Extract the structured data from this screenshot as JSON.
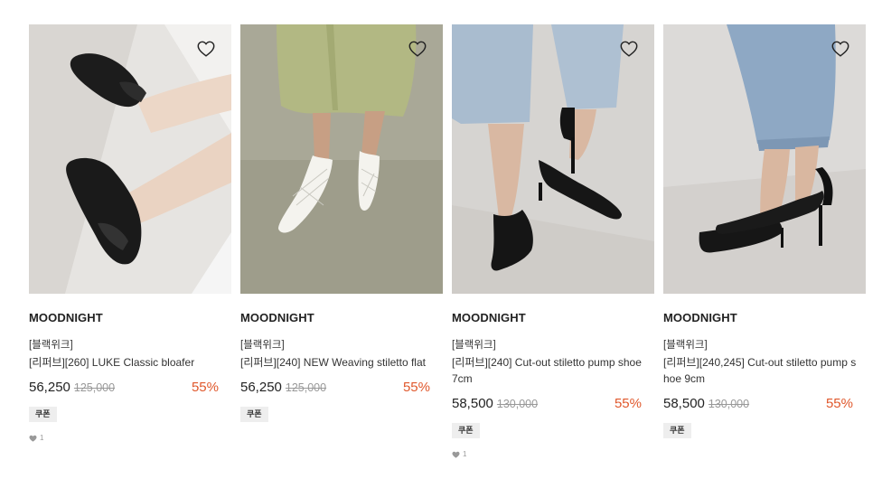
{
  "products": [
    {
      "brand": "MOODNIGHT",
      "tag": "[블랙위크]",
      "name": "[리퍼브][260] LUKE Classic bloafer",
      "price": "56,250",
      "original_price": "125,000",
      "discount": "55%",
      "coupon": "쿠폰",
      "likes": "1",
      "image_desc": "black-mule-loafers"
    },
    {
      "brand": "MOODNIGHT",
      "tag": "[블랙위크]",
      "name": "[리퍼브][240] NEW Weaving stiletto flat",
      "price": "56,250",
      "original_price": "125,000",
      "discount": "55%",
      "coupon": "쿠폰",
      "likes": "",
      "image_desc": "white-woven-flats"
    },
    {
      "brand": "MOODNIGHT",
      "tag": "[블랙위크]",
      "name": "[리퍼브][240] Cut-out stiletto pump shoe 7cm",
      "price": "58,500",
      "original_price": "130,000",
      "discount": "55%",
      "coupon": "쿠폰",
      "likes": "1",
      "image_desc": "black-cutout-pumps-7cm"
    },
    {
      "brand": "MOODNIGHT",
      "tag": "[블랙위크]",
      "name": "[리퍼브][240,245] Cut-out stiletto pump shoe 9cm",
      "price": "58,500",
      "original_price": "130,000",
      "discount": "55%",
      "coupon": "쿠폰",
      "likes": "",
      "image_desc": "black-cutout-pumps-9cm"
    }
  ],
  "colors": {
    "discount": "#e0582c",
    "coupon_bg": "#eeeeee",
    "strike": "#999999"
  },
  "icons": {
    "wishlist": "heart-outline-icon",
    "likes": "heart-filled-icon"
  }
}
